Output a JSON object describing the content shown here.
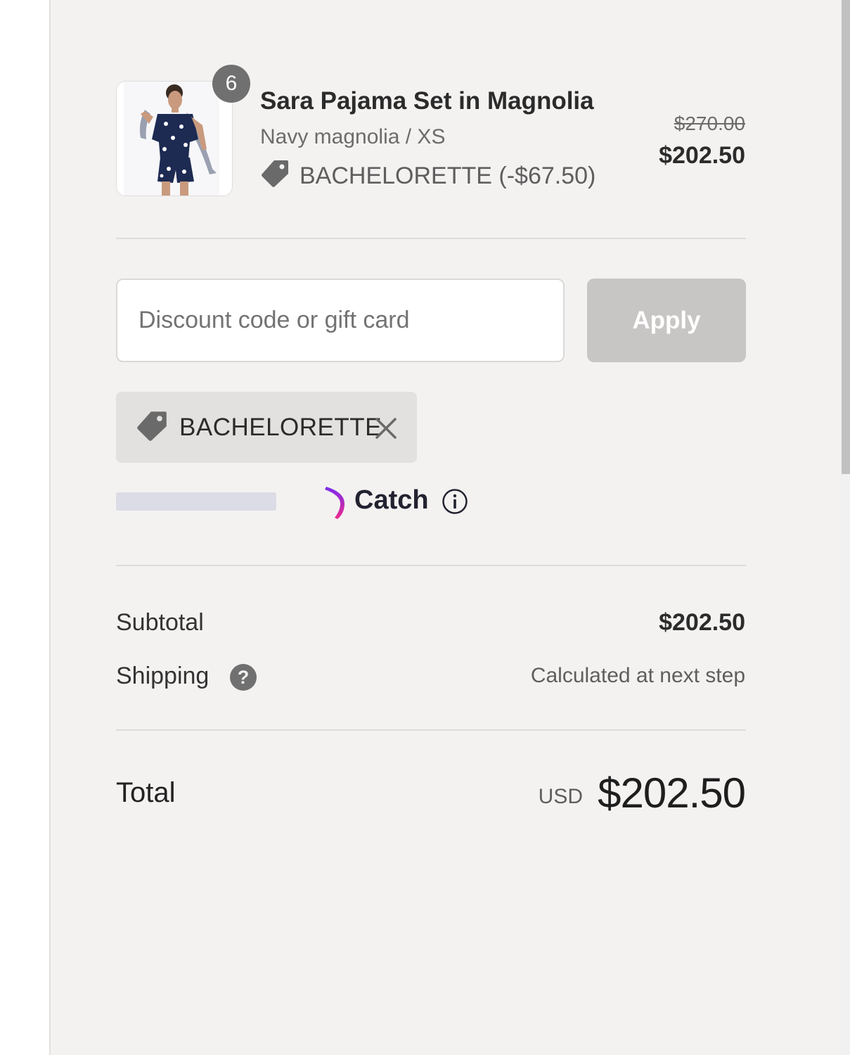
{
  "line_item": {
    "image_alt": "Sara Pajama Set in Magnolia",
    "quantity": "6",
    "name": "Sara Pajama Set in Magnolia",
    "variant": "Navy magnolia / XS",
    "discount_text": "BACHELORETTE (-$67.50)",
    "original_price": "$270.00",
    "price": "$202.50"
  },
  "discount_form": {
    "placeholder": "Discount code or gift card",
    "value": "",
    "apply_label": "Apply"
  },
  "applied_code": {
    "code": "BACHELORETTE",
    "remove_icon": "close-icon"
  },
  "catch": {
    "label": "Catch",
    "info_icon": "info-icon"
  },
  "summary": {
    "subtotal_label": "Subtotal",
    "subtotal_value": "$202.50",
    "shipping_label": "Shipping",
    "shipping_help": "?",
    "shipping_value": "Calculated at next step",
    "total_label": "Total",
    "total_currency": "USD",
    "total_value": "$202.50"
  },
  "colors": {
    "panel_background": "#f4f2f1",
    "apply_button_disabled": "#c8c6c5",
    "chip_background": "#e3e1df",
    "badge": "#707070",
    "catch_gradient_start": "#7b2cf0",
    "catch_gradient_end": "#ee2a8c"
  }
}
